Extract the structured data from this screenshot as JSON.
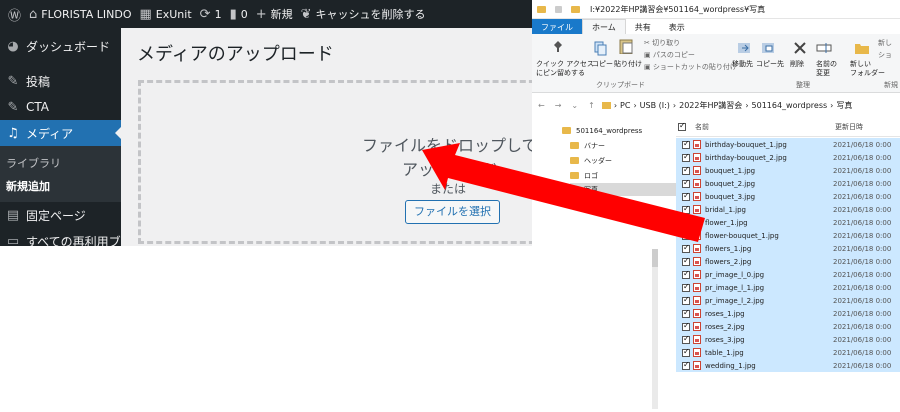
{
  "adminbar": {
    "site_name": "FLORISTA LINDO",
    "exunit": "ExUnit",
    "updates_count": "1",
    "comments_count": "0",
    "new_label": "新規",
    "cache_label": "キャッシュを削除する"
  },
  "sidebar": {
    "items": [
      {
        "label": "ダッシュボード",
        "icon": "gauge-icon"
      },
      {
        "label": "投稿",
        "icon": "pin-icon"
      },
      {
        "label": "CTA",
        "icon": "pin-icon"
      },
      {
        "label": "メディア",
        "icon": "media-icon"
      },
      {
        "label": "固定ページ",
        "icon": "page-icon"
      },
      {
        "label": "すべての再利用ブ",
        "icon": "block-icon"
      }
    ],
    "submenu": [
      "ライブラリ",
      "新規追加"
    ]
  },
  "main": {
    "title": "メディアのアップロード",
    "drop_line1": "ファイルをドロップして",
    "drop_line2": "アップロード",
    "or_text": "または",
    "select_button": "ファイルを選択"
  },
  "explorer": {
    "window_title": "I:¥2022年HP講習会¥501164_wordpress¥写真",
    "tabs": [
      "ファイル",
      "ホーム",
      "共有",
      "表示"
    ],
    "ribbon": {
      "pin": "クイック アクセス\nにピン留めする",
      "copy": "コピー",
      "paste": "貼り付け",
      "cut": "切り取り",
      "copy_path": "パスのコピー",
      "paste_shortcut": "ショートカットの貼り付け",
      "clipboard_group": "クリップボード",
      "move_to": "移動先",
      "copy_to": "コピー先",
      "delete": "削除",
      "rename": "名前の\n変更",
      "organize_group": "整理",
      "new_folder": "新しい\nフォルダー",
      "new_item": "新し",
      "easy_access": "ショ",
      "new_group": "新規"
    },
    "address": [
      "PC",
      "USB (I:)",
      "2022年HP講習会",
      "501164_wordpress",
      "写真"
    ],
    "tree": [
      "501164_wordpress",
      "バナー",
      "ヘッダー",
      "ロゴ",
      "写真"
    ],
    "columns": {
      "name": "名前",
      "date": "更新日時"
    },
    "files": [
      {
        "name": "birthday-bouquet_1.jpg",
        "date": "2021/06/18 0:00"
      },
      {
        "name": "birthday-bouquet_2.jpg",
        "date": "2021/06/18 0:00"
      },
      {
        "name": "bouquet_1.jpg",
        "date": "2021/06/18 0:00"
      },
      {
        "name": "bouquet_2.jpg",
        "date": "2021/06/18 0:00"
      },
      {
        "name": "bouquet_3.jpg",
        "date": "2021/06/18 0:00"
      },
      {
        "name": "bridal_1.jpg",
        "date": "2021/06/18 0:00"
      },
      {
        "name": "flower_1.jpg",
        "date": "2021/06/18 0:00"
      },
      {
        "name": "flower-bouquet_1.jpg",
        "date": "2021/06/18 0:00"
      },
      {
        "name": "flowers_1.jpg",
        "date": "2021/06/18 0:00"
      },
      {
        "name": "flowers_2.jpg",
        "date": "2021/06/18 0:00"
      },
      {
        "name": "pr_image_l_0.jpg",
        "date": "2021/06/18 0:00"
      },
      {
        "name": "pr_image_l_1.jpg",
        "date": "2021/06/18 0:00"
      },
      {
        "name": "pr_image_l_2.jpg",
        "date": "2021/06/18 0:00"
      },
      {
        "name": "roses_1.jpg",
        "date": "2021/06/18 0:00"
      },
      {
        "name": "roses_2.jpg",
        "date": "2021/06/18 0:00"
      },
      {
        "name": "roses_3.jpg",
        "date": "2021/06/18 0:00"
      },
      {
        "name": "table_1.jpg",
        "date": "2021/06/18 0:00"
      },
      {
        "name": "wedding_1.jpg",
        "date": "2021/06/18 0:00"
      }
    ]
  },
  "colors": {
    "wp_accent": "#2271b1",
    "arrow": "#ff0000",
    "selection": "#cce8ff"
  }
}
